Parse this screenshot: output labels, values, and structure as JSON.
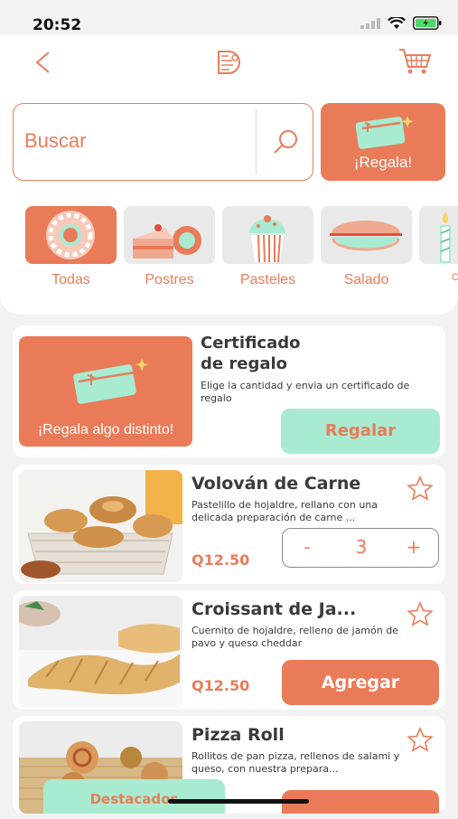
{
  "status_bar": {
    "time": "20:52"
  },
  "search": {
    "placeholder": "Buscar"
  },
  "gift_button": {
    "label": "¡Regala!"
  },
  "categories": [
    {
      "label": "Todas",
      "active": true
    },
    {
      "label": "Postres",
      "active": false
    },
    {
      "label": "Pasteles",
      "active": false
    },
    {
      "label": "Salado",
      "active": false
    },
    {
      "label": "Comp",
      "active": false
    }
  ],
  "gift_card": {
    "image_text": "¡Regala algo distinto!",
    "title_line1": "Certificado",
    "title_line2": "de regalo",
    "description": "Elige la cantidad y envia un certificado de regalo",
    "button_label": "Regalar"
  },
  "products": [
    {
      "name": "Volován de Carne",
      "description": "Pastelillo de hojaldre, rellano con una delicada preparación de carne ...",
      "price": "Q12.50",
      "quantity": "3",
      "minus": "-",
      "plus": "+"
    },
    {
      "name": "Croissant de Ja...",
      "description": "Cuernito de hojaldre, relleno de jamón de pavo y queso cheddar",
      "price": "Q12.50",
      "button_label": "Agregar"
    },
    {
      "name": "Pizza Roll",
      "description": "Rollitos de pan pizza, rellenos de salami y queso, con nuestra prepara..."
    }
  ],
  "bottom_tab": {
    "label": "Destacados"
  },
  "colors": {
    "accent": "#ea7b59",
    "mint": "#a8ebd0",
    "background": "#f2f2f2"
  }
}
